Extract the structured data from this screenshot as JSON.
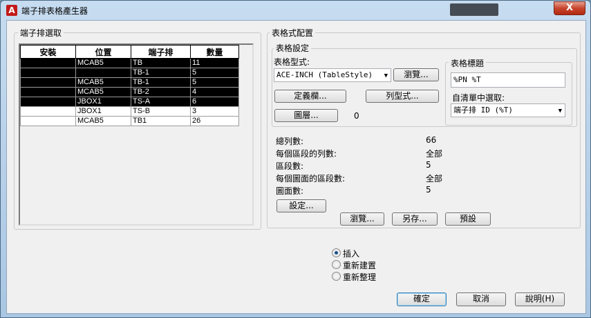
{
  "window": {
    "title": "端子排表格產生器",
    "app_icon": "A",
    "close_glyph": "X"
  },
  "terminal_strips": {
    "group_label": "端子排選取",
    "headers": [
      "安裝",
      "位置",
      "端子排",
      "數量"
    ],
    "rows": [
      {
        "install": "",
        "location": "MCAB5",
        "strip": "TB",
        "count": "11",
        "selected": true
      },
      {
        "install": "",
        "location": "",
        "strip": "TB-1",
        "count": "5",
        "selected": true
      },
      {
        "install": "",
        "location": "MCAB5",
        "strip": "TB-1",
        "count": "5",
        "selected": true
      },
      {
        "install": "",
        "location": "MCAB5",
        "strip": "TB-2",
        "count": "4",
        "selected": true
      },
      {
        "install": "",
        "location": "JBOX1",
        "strip": "TS-A",
        "count": "6",
        "selected": true
      },
      {
        "install": "",
        "location": "JBOX1",
        "strip": "TS-B",
        "count": "3",
        "selected": false
      },
      {
        "install": "",
        "location": "MCAB5",
        "strip": "TB1",
        "count": "26",
        "selected": false
      }
    ]
  },
  "table_format": {
    "group_label": "表格式配置",
    "settings_label": "表格設定",
    "style_label": "表格型式:",
    "style_value": "ACE-INCH (TableStyle)",
    "browse_style_button": "瀏覽...",
    "define_columns_button": "定義欄...",
    "row_style_button": "列型式...",
    "layer_button": "圖層...",
    "layer_value": "0",
    "title_label": "表格標題",
    "title_value": "%PN %T",
    "pick_label": "自清單中選取:",
    "pick_value": "端子排 ID (%T)"
  },
  "stats": {
    "items": [
      {
        "label": "總列數:",
        "value": "66"
      },
      {
        "label": "每個區段的列數:",
        "value": "全部"
      },
      {
        "label": "區段數:",
        "value": "5"
      },
      {
        "label": "每個圖面的區段數:",
        "value": "全部"
      },
      {
        "label": "圖面數:",
        "value": "5"
      }
    ],
    "settings_button": "設定...",
    "browse_button": "瀏覽...",
    "save_as_button": "另存...",
    "default_button": "預設"
  },
  "insert_options": {
    "options": [
      {
        "label": "插入",
        "checked": true
      },
      {
        "label": "重新建置",
        "checked": false
      },
      {
        "label": "重新整理",
        "checked": false
      }
    ]
  },
  "footer": {
    "ok_button": "確定",
    "cancel_button": "取消",
    "help_button": "說明(H)"
  }
}
